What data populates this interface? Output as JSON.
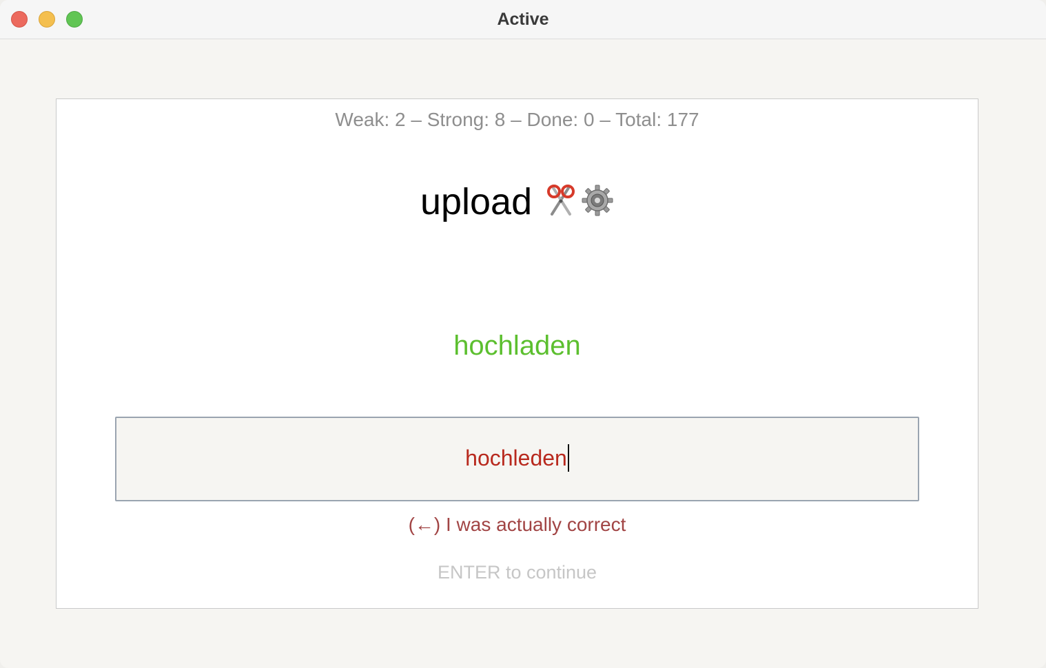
{
  "window": {
    "title": "Active"
  },
  "stats": {
    "text": "Weak: 2 – Strong: 8 – Done: 0 – Total: 177"
  },
  "prompt": {
    "word": "upload",
    "icons": [
      "scissors-icon",
      "gear-icon"
    ]
  },
  "answer": {
    "correct": "hochladen"
  },
  "input": {
    "value": "hochleden"
  },
  "feedback": {
    "override_label": "(←) I was actually correct",
    "continue_hint": "ENTER to continue"
  },
  "colors": {
    "correct_answer": "#5cbf2f",
    "wrong_input": "#b8291e",
    "override": "#a14444",
    "hint": "#c6c6c6",
    "stats": "#8e8e8e"
  }
}
